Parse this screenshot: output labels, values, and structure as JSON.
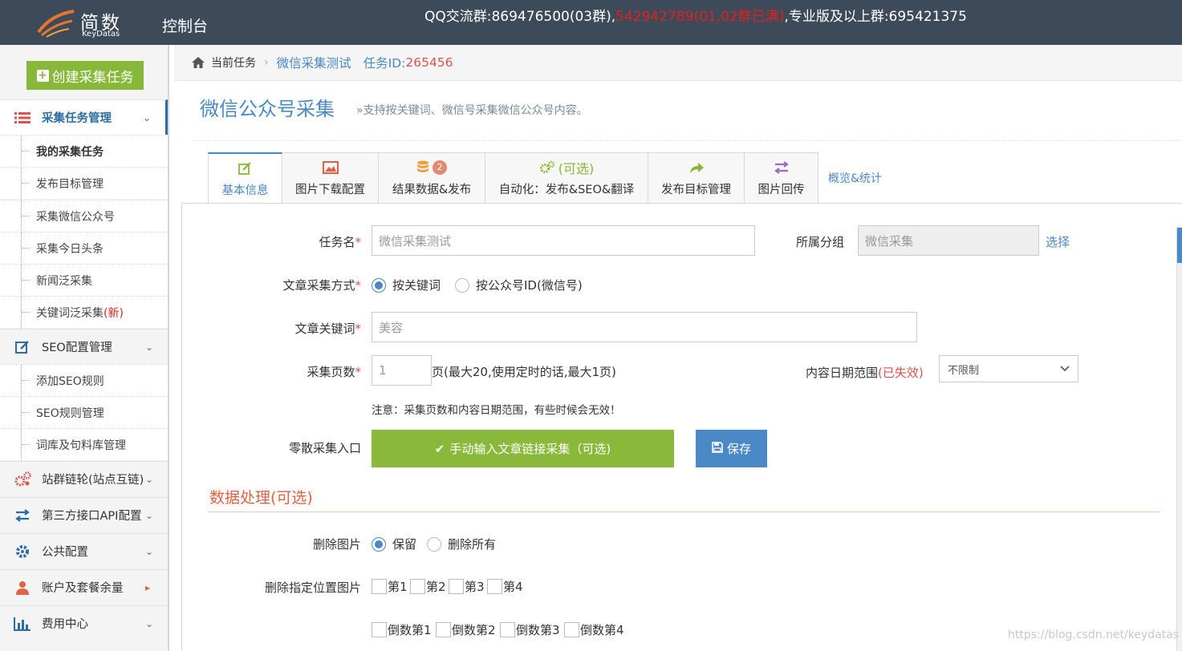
{
  "header": {
    "logo_cn": "简数",
    "logo_en": "KeyDatas",
    "console": "控制台",
    "qq_prefix": "QQ交流群:869476500(03群),",
    "qq_full": "542942789(01,02群已满)",
    "qq_suffix": ",专业版及以上群:695421375"
  },
  "sidebar": {
    "create_label": "创建采集任务",
    "sections": [
      {
        "label": "采集任务管理",
        "icon": "list-icon",
        "items": [
          "我的采集任务",
          "发布目标管理",
          "采集微信公众号",
          "采集今日头条",
          "新闻泛采集",
          "关键词泛采集"
        ]
      },
      {
        "label": "SEO配置管理",
        "icon": "edit-icon",
        "items": [
          "添加SEO规则",
          "SEO规则管理",
          "词库及句料库管理"
        ]
      },
      {
        "label": "站群链轮(站点互链)",
        "icon": "gears-icon"
      },
      {
        "label": "第三方接口API配置",
        "icon": "exchange-icon"
      },
      {
        "label": "公共配置",
        "icon": "gear-icon"
      },
      {
        "label": "账户及套餐余量",
        "icon": "user-icon"
      },
      {
        "label": "费用中心",
        "icon": "bar-chart-icon"
      }
    ],
    "new_tag": "(新)"
  },
  "breadcrumb": {
    "current": "当前任务",
    "task_name": "微信采集测试",
    "task_id_label": "任务ID:",
    "task_id": "265456"
  },
  "page": {
    "title": "微信公众号采集",
    "subtitle": "»支持按关键词、微信号采集微信公众号内容。"
  },
  "tabs": [
    {
      "label": "基本信息",
      "icon": "edit-icon",
      "active": true
    },
    {
      "label": "图片下载配置",
      "icon": "image-icon"
    },
    {
      "label": "结果数据&发布",
      "icon": "database-icon",
      "badge": "2"
    },
    {
      "label": "自动化：发布&SEO&翻译",
      "icon": "gears-icon",
      "icon_text": "(可选)"
    },
    {
      "label": "发布目标管理",
      "icon": "share-icon"
    },
    {
      "label": "图片回传",
      "icon": "exchange-icon"
    }
  ],
  "overview_link": "概览&统计",
  "form": {
    "task_name_label": "任务名",
    "task_name_value": "微信采集测试",
    "group_label": "所属分组",
    "group_value": "微信采集",
    "group_select": "选择",
    "method_label": "文章采集方式",
    "method_opt1": "按关键词",
    "method_opt2": "按公众号ID(微信号)",
    "keyword_label": "文章关键词",
    "keyword_value": "美容",
    "pages_label": "采集页数",
    "pages_value": "1",
    "pages_hint": "页(最大20,使用定时的话,最大1页)",
    "date_label": "内容日期范围",
    "date_expired": "(已失效)",
    "date_value": "不限制",
    "note": "注意：采集页数和内容日期范围，有些时候会无效！",
    "manual_label": "零散采集入口",
    "manual_btn": "手动输入文章链接采集（可选)",
    "save_btn": "保存"
  },
  "processing": {
    "title": "数据处理(可选)",
    "delete_img_label": "删除图片",
    "keep": "保留",
    "delete_all": "删除所有",
    "pos_label": "删除指定位置图片",
    "pos_front": [
      "第1",
      "第2",
      "第3",
      "第4"
    ],
    "pos_back": [
      "倒数第1",
      "倒数第2",
      "倒数第3",
      "倒数第4"
    ]
  },
  "watermark": "https://blog.csdn.net/keydatas",
  "colors": {
    "header_bg": "#3d4a5a",
    "accent": "#4a88c6",
    "green": "#8ab83a",
    "red": "#e02020"
  }
}
